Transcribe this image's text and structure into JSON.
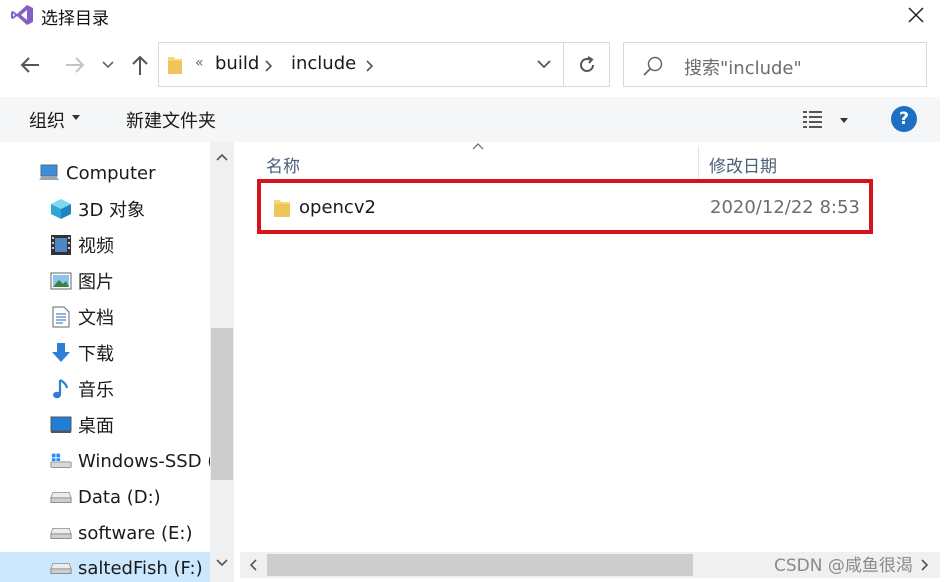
{
  "window": {
    "title": "选择目录",
    "close_icon": "close-icon"
  },
  "address": {
    "crumb_prefix": "«",
    "crumbs": [
      "build",
      "include"
    ],
    "search_placeholder": "搜索\"include\""
  },
  "toolbar": {
    "organize_label": "组织",
    "new_folder_label": "新建文件夹",
    "help_label": "?"
  },
  "nav": {
    "items": [
      {
        "label": "Computer",
        "icon": "computer-icon"
      },
      {
        "label": "3D 对象",
        "icon": "cube-icon"
      },
      {
        "label": "视频",
        "icon": "film-icon"
      },
      {
        "label": "图片",
        "icon": "picture-icon"
      },
      {
        "label": "文档",
        "icon": "document-icon"
      },
      {
        "label": "下载",
        "icon": "download-icon"
      },
      {
        "label": "音乐",
        "icon": "music-icon"
      },
      {
        "label": "桌面",
        "icon": "desktop-icon"
      },
      {
        "label": "Windows-SSD (",
        "icon": "drive-os-icon"
      },
      {
        "label": "Data (D:)",
        "icon": "drive-icon"
      },
      {
        "label": "software (E:)",
        "icon": "drive-icon"
      },
      {
        "label": "saltedFish (F:)",
        "icon": "drive-icon"
      }
    ]
  },
  "content": {
    "columns": {
      "name": "名称",
      "date_modified": "修改日期"
    },
    "rows": [
      {
        "name": "opencv2",
        "date_modified": "2020/12/22 8:53",
        "icon": "folder-icon"
      }
    ]
  },
  "watermark": "CSDN @咸鱼很渴",
  "colors": {
    "highlight_border": "#d7141d",
    "help_blue": "#1e6fc4",
    "folder_yellow": "#f8d775",
    "selection_blue": "#cce8ff"
  }
}
